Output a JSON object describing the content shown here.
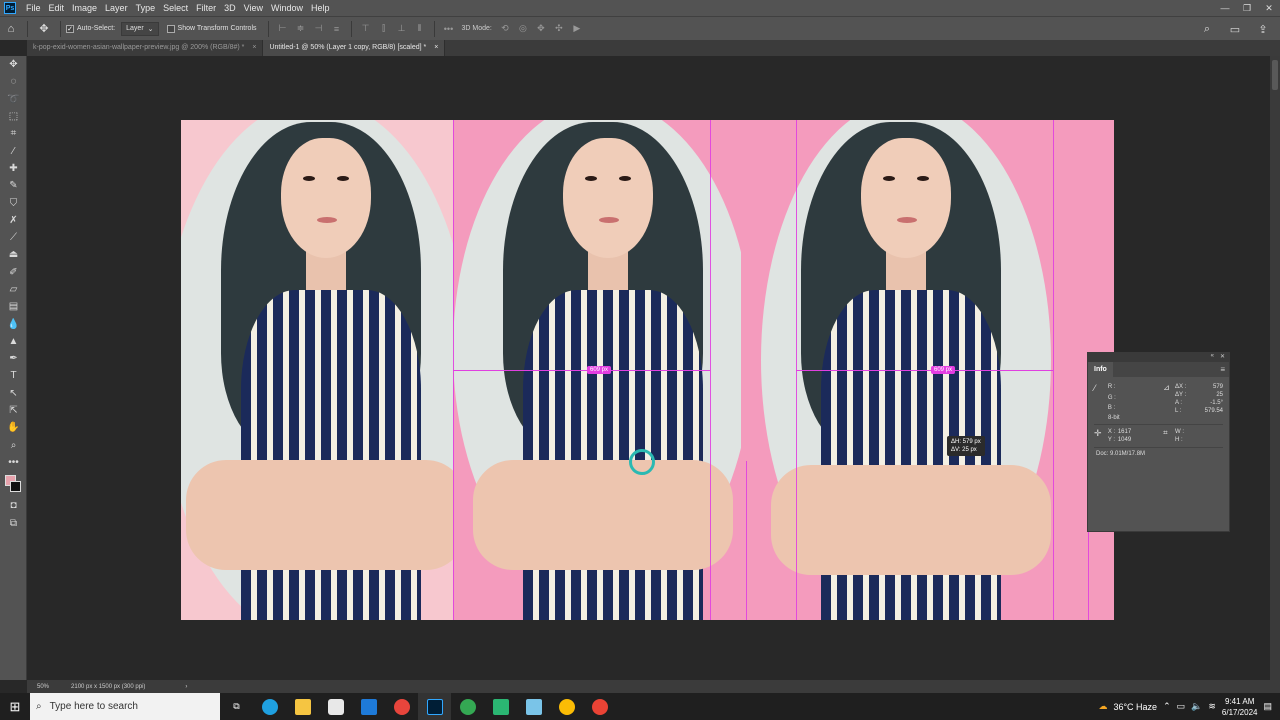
{
  "app": {
    "logo": "Ps",
    "menu": [
      "File",
      "Edit",
      "Image",
      "Layer",
      "Type",
      "Select",
      "Filter",
      "3D",
      "View",
      "Window",
      "Help"
    ]
  },
  "options": {
    "auto_select_label": "Auto-Select:",
    "auto_select_value": "Layer",
    "show_transform_label": "Show Transform Controls",
    "mode_3d_label": "3D Mode:"
  },
  "tabs": [
    {
      "label": "k-pop-exid-women-asian-wallpaper-preview.jpg @ 200% (RGB/8#) *",
      "close": "×"
    },
    {
      "label": "Untitled-1 @ 50% (Layer 1 copy, RGB/8) [scaled] *",
      "close": "×"
    }
  ],
  "canvas": {
    "measure_left": "609 px",
    "measure_right": "609 px",
    "readout_line1": "ΔH: 579 px",
    "readout_line2": "ΔV: 25 px"
  },
  "info_panel": {
    "title": "Info",
    "r_label": "R :",
    "g_label": "G :",
    "b_label": "B :",
    "bit_depth": "8-bit",
    "dx_label": "ΔX :",
    "dx_value": "579",
    "dy_label": "ΔY :",
    "dy_value": "25",
    "a_label": "A :",
    "a_value": "-1.5°",
    "l_label": "L :",
    "l_value": "579.54",
    "x_label": "X :",
    "x_value": "1617",
    "y_label": "Y :",
    "y_value": "1049",
    "w_label": "W :",
    "h_label": "H :",
    "doc_text": "Doc: 9.01M/17.8M"
  },
  "status": {
    "zoom": "50%",
    "doc_size": "2100 px x 1500 px (300 ppi)"
  },
  "taskbar": {
    "search_placeholder": "Type here to search",
    "weather": "36°C  Haze",
    "time": "9:41 AM",
    "date": "6/17/2024"
  },
  "colors": {
    "foreground": "#e8a3ad",
    "background": "#111111",
    "canvas_pink": "#f49bbd",
    "guide": "#e040e0"
  }
}
